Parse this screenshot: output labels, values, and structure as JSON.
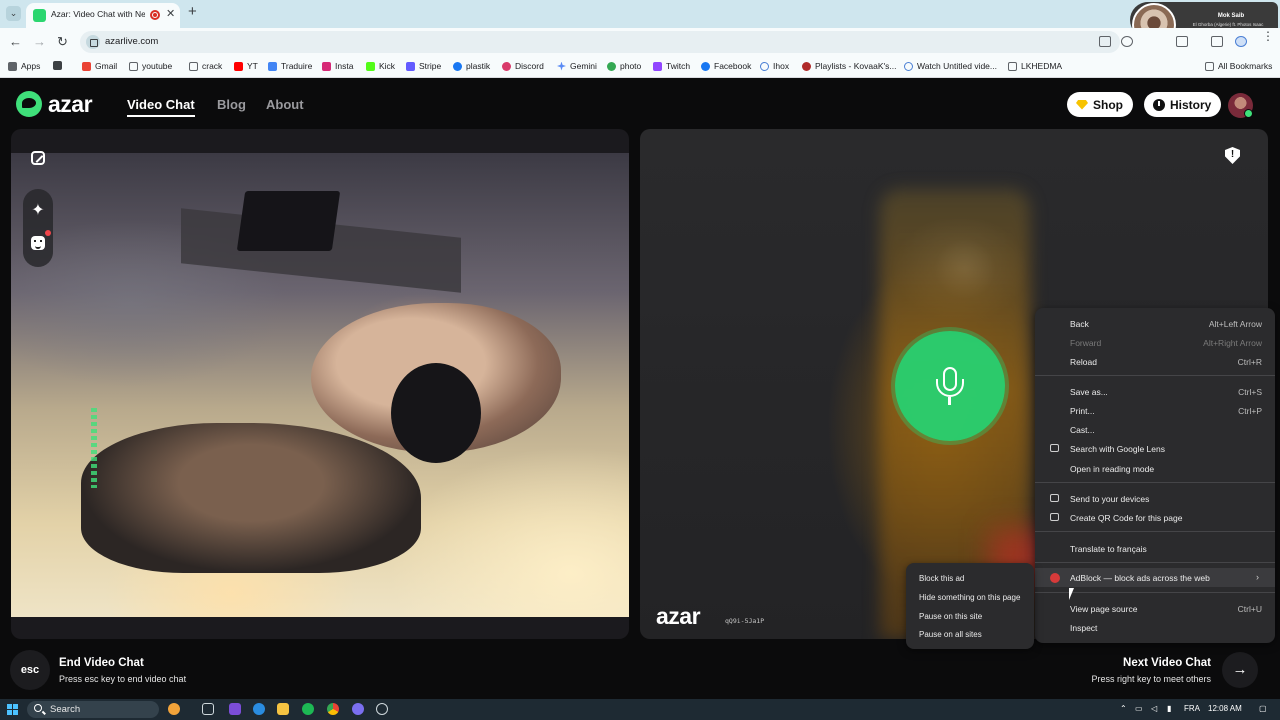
{
  "browser": {
    "tab_title": "Azar: Video Chat with New",
    "url": "azarlive.com",
    "bookmarks": [
      "Apps",
      "Gmail",
      "youtube",
      "crack",
      "YT",
      "Traduire",
      "Insta",
      "Kick",
      "Stripe",
      "plastik",
      "Discord",
      "Gemini",
      "photo",
      "Twitch",
      "Facebook",
      "Ihox",
      "Playlists - KovaaK's...",
      "Watch Untitled vide...",
      "LKHEDMA"
    ],
    "all_bookmarks": "All Bookmarks"
  },
  "pip_overlay": {
    "name": "Mok Saib",
    "subtitle": "El Ghorba (Algerie) ft. Photos Isaac A.ItsRadio"
  },
  "site": {
    "logo": "azar",
    "nav": [
      "Video Chat",
      "Blog",
      "About"
    ],
    "shop": "Shop",
    "history": "History"
  },
  "remote": {
    "watermark": "azar",
    "code": "qQ9i-5Ja1P"
  },
  "footer": {
    "esc_key": "esc",
    "end_title": "End Video Chat",
    "end_sub": "Press esc key to end video chat",
    "next_title": "Next Video Chat",
    "next_sub": "Press right key to meet others"
  },
  "context_menu": {
    "back": "Back",
    "back_sc": "Alt+Left Arrow",
    "forward": "Forward",
    "forward_sc": "Alt+Right Arrow",
    "reload": "Reload",
    "reload_sc": "Ctrl+R",
    "save_as": "Save as...",
    "save_as_sc": "Ctrl+S",
    "print": "Print...",
    "print_sc": "Ctrl+P",
    "cast": "Cast...",
    "lens": "Search with Google Lens",
    "reading": "Open in reading mode",
    "send": "Send to your devices",
    "qr": "Create QR Code for this page",
    "translate": "Translate to français",
    "adblock": "AdBlock — block ads across the web",
    "view_source": "View page source",
    "view_source_sc": "Ctrl+U",
    "inspect": "Inspect"
  },
  "adblock_submenu": [
    "Block this ad",
    "Hide something on this page",
    "Pause on this site",
    "Pause on all sites"
  ],
  "taskbar": {
    "search": "Search",
    "lang": "FRA",
    "time": "12:08 AM"
  }
}
